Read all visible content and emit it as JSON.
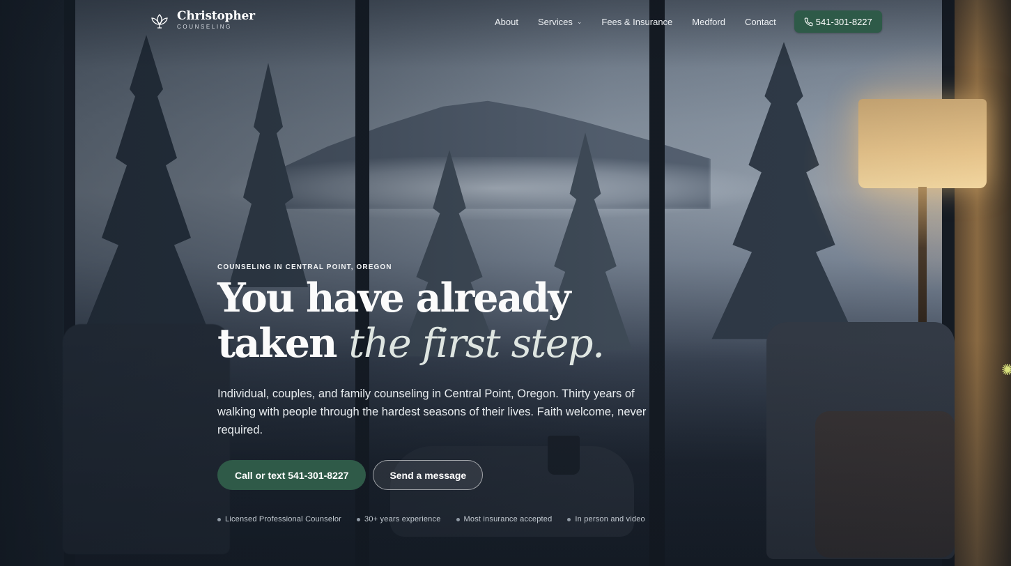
{
  "brand": {
    "name": "Christopher",
    "sub": "COUNSELING",
    "icon": "lotus-icon"
  },
  "nav": {
    "items": [
      {
        "label": "About"
      },
      {
        "label": "Services",
        "has_dropdown": true
      },
      {
        "label": "Fees & Insurance"
      },
      {
        "label": "Medford"
      },
      {
        "label": "Contact"
      }
    ],
    "phone_button": {
      "label": "541-301-8227",
      "icon": "phone-icon"
    }
  },
  "hero": {
    "eyebrow": "COUNSELING IN CENTRAL POINT, OREGON",
    "headline_line1": "You have already",
    "headline_line2_plain": "taken",
    "headline_line2_italic": "the first step.",
    "lede": "Individual, couples, and family counseling in Central Point, Oregon. Thirty years of walking with people through the hardest seasons of their lives. Faith welcome, never required.",
    "primary_cta": "Call or text 541-301-8227",
    "secondary_cta": "Send a message",
    "badges": [
      "Licensed Professional Counselor",
      "30+ years experience",
      "Most insurance accepted",
      "In person and video"
    ]
  },
  "colors": {
    "accent_green": "#2e5a48",
    "text": "#ffffff"
  }
}
